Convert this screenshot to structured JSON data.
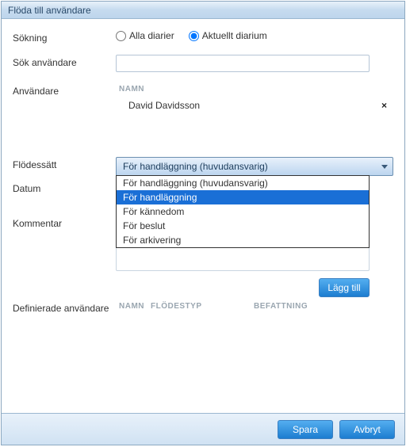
{
  "window": {
    "title": "Flöda till användare"
  },
  "labels": {
    "search": "Sökning",
    "searchUser": "Sök användare",
    "user": "Användare",
    "flowType": "Flödessätt",
    "date": "Datum",
    "comment": "Kommentar",
    "defined": "Definierade användare"
  },
  "radios": {
    "all": "Alla diarier",
    "current": "Aktuellt diarium"
  },
  "userTable": {
    "header_name": "NAMN",
    "rows": [
      {
        "name": "David Davidsson"
      }
    ]
  },
  "combo": {
    "selected": "För handläggning (huvudansvarig)",
    "options": [
      "För handläggning (huvudansvarig)",
      "För handläggning",
      "För kännedom",
      "För beslut",
      "För arkivering"
    ],
    "highlightIndex": 1
  },
  "buttons": {
    "add": "Lägg till",
    "save": "Spara",
    "cancel": "Avbryt"
  },
  "defined": {
    "col_name": "NAMN",
    "col_type": "FLÖDESTYP",
    "col_position": "BEFATTNING"
  },
  "remove_symbol": "×"
}
